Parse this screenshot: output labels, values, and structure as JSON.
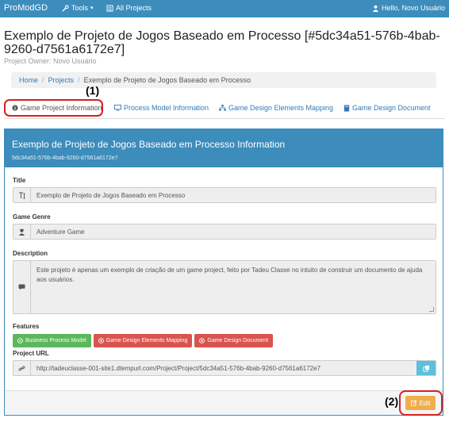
{
  "navbar": {
    "brand": "ProModGD",
    "tools_label": "Tools",
    "projects_label": "All Projects",
    "user_label": "Hello, Novo Usuário"
  },
  "header": {
    "title": "Exemplo de Projeto de Jogos Baseado em Processo [#5dc34a51-576b-4bab-9260-d7561a6172e7]",
    "owner": "Project Owner: Novo Usuário"
  },
  "breadcrumb": [
    "Home",
    "Projects",
    "Exemplo de Projeto de Jogos Baseado em Processo"
  ],
  "annotations": {
    "one": "(1)",
    "two": "(2)"
  },
  "tabs": [
    {
      "label": "Game Project Information",
      "icon": "info-circle-icon",
      "active": true
    },
    {
      "label": "Process Model Information",
      "icon": "monitor-icon",
      "active": false
    },
    {
      "label": "Game Design Elements Mapping",
      "icon": "sitemap-icon",
      "active": false
    },
    {
      "label": "Game Design Document",
      "icon": "book-icon",
      "active": false
    }
  ],
  "panel": {
    "title": "Exemplo de Projeto de Jogos Baseado em Processo Information",
    "subtitle": "5dc34a51-576b-4bab-9260-d7561a6172e7",
    "fields": {
      "title_label": "Title",
      "title_value": "Exemplo de Projeto de Jogos Baseado em Processo",
      "genre_label": "Game Genre",
      "genre_value": "Adventure Game",
      "description_label": "Description",
      "description_value": "Este projeto é apenas um exemplo de criação de um game project, feito por Tadeu Classe no intuito de construir um documento de ajuda aos usuários.",
      "features_label": "Features",
      "url_label": "Project URL",
      "url_value": "http://tadeuclasse-001-site1.dtempurl.com/Project/Project/5dc34a51-576b-4bab-9260-d7561a6172e7"
    },
    "features": [
      {
        "label": "Business Process Model",
        "color": "#5cb85c"
      },
      {
        "label": "Game Design Elements Mapping",
        "color": "#d9534f"
      },
      {
        "label": "Game Design Document",
        "color": "#d9534f"
      }
    ],
    "edit_label": "Edit"
  },
  "colors": {
    "primary": "#3c8dbc",
    "warning": "#f0ad4e",
    "highlight": "#d62020"
  }
}
